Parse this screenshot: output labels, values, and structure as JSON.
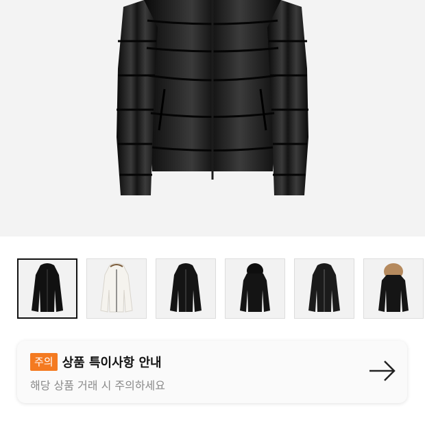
{
  "notice": {
    "badge": "주의",
    "title": "상품 특이사항 안내",
    "subtitle": "해당 상품 거래 시 주의하세요",
    "badge_color": "#f47a20"
  },
  "thumbnails": [
    {
      "name": "black glossy puffer jacket front",
      "selected": true
    },
    {
      "name": "white puffer jacket",
      "selected": false
    },
    {
      "name": "black glossy puffer jacket hooded",
      "selected": false
    },
    {
      "name": "black puffer jacket hood up",
      "selected": false
    },
    {
      "name": "black belted puffer jacket",
      "selected": false
    },
    {
      "name": "black puffer jacket with fur hood",
      "selected": false
    }
  ],
  "icons": {
    "arrow": "arrow-right-icon"
  }
}
